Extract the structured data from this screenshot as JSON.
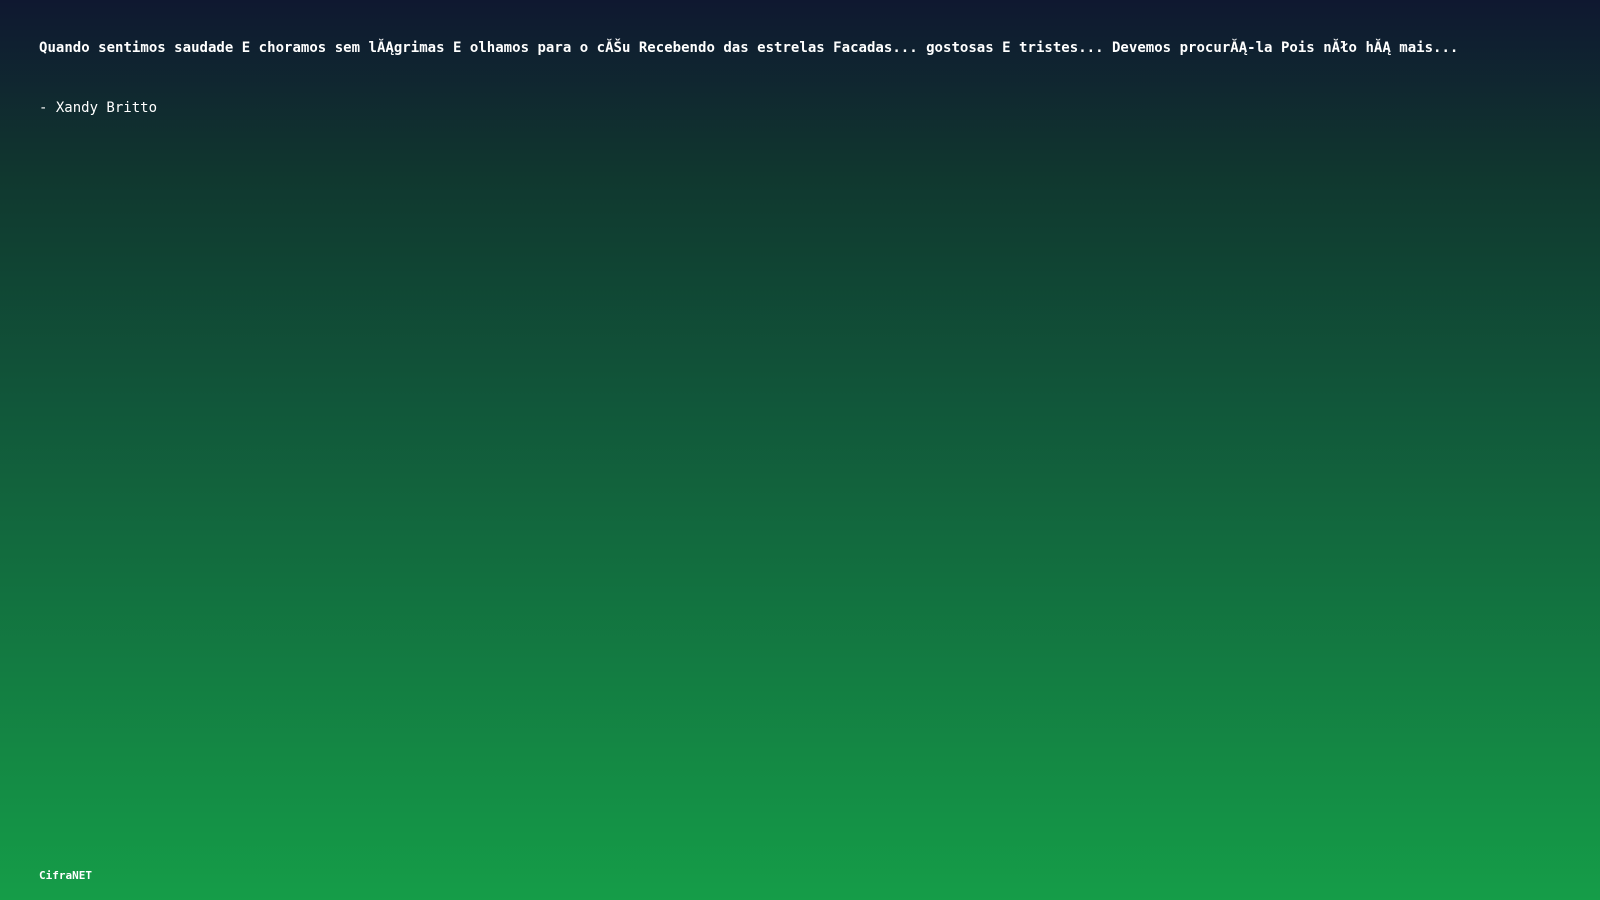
{
  "colors": {
    "background_top": "#0f1830",
    "background_bottom": "#159d48",
    "text": "#ffffff"
  },
  "quote": {
    "text": "Quando sentimos saudade E choramos sem lĂĄgrimas E olhamos para o cĂŠu Recebendo das estrelas Facadas... gostosas E tristes... Devemos procurĂĄ-la Pois nĂło hĂĄ mais...",
    "author": "- Xandy Britto"
  },
  "brand": {
    "name": "CifraNET"
  }
}
